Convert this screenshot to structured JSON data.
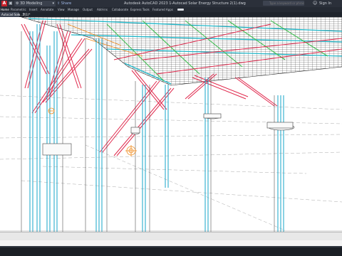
{
  "titlebar": {
    "logo_letter": "A",
    "workspace": "3D Modeling",
    "share": "Share",
    "title": "Autodesk AutoCAD 2023   1-Autocad Solar Energy Structure 2(1).dwg",
    "search_placeholder": "Type a keyword or phrase",
    "signin": "Sign In"
  },
  "ribbon": {
    "tabs": [
      "Home",
      "Parametric",
      "Insert",
      "Annotate",
      "View",
      "Manage",
      "Output",
      "Add-ins",
      "Collaborate",
      "Express Tools",
      "Featured Apps"
    ],
    "active_index": 0
  },
  "file_tabs": {
    "current": "Autocad Sola...2(1)*"
  },
  "colors": {
    "titlebar": "#2b303a",
    "ribbon": "#252a33",
    "accent": "#4aa3ff",
    "steel_cyan": "#16a6c9",
    "bracing_red": "#e0284c",
    "panel_green": "#3fbf50",
    "highlight_orange": "#f08a1a"
  }
}
